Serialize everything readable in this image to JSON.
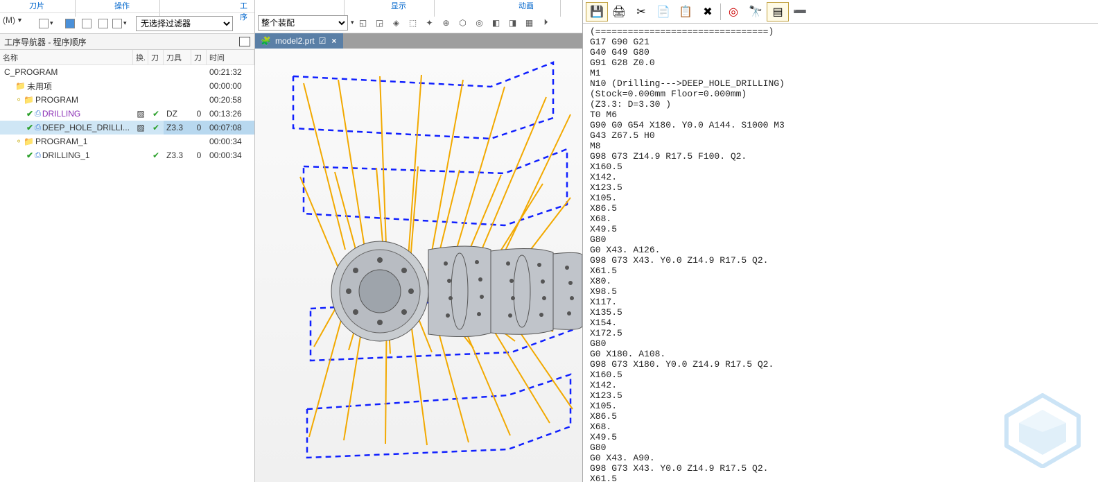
{
  "ribbon": {
    "tab_tool": "刀片",
    "tab_ops": "操作",
    "tab_prog": "工序",
    "tab_display": "显示",
    "tab_anim": "动画",
    "menu_dropdown_label": "(M)",
    "filter_placeholder": "无选择过滤器",
    "assembly_placeholder": "整个装配"
  },
  "navigator": {
    "title": "工序导航器 - 程序顺序",
    "cols": {
      "name": "名称",
      "swap": "换.",
      "tool_sym": "刀",
      "tool": "刀具",
      "tool2": "刀",
      "time": "时间"
    }
  },
  "tree": [
    {
      "indent": 0,
      "name": "C_PROGRAM",
      "icon": "",
      "time": "00:21:32",
      "swap": "",
      "check": "",
      "tool": "",
      "tool2": ""
    },
    {
      "indent": 1,
      "name": "未用项",
      "icon": "folder",
      "time": "00:00:00",
      "swap": "",
      "check": "",
      "tool": "",
      "tool2": ""
    },
    {
      "indent": 1,
      "name": "PROGRAM",
      "icon": "folder",
      "time": "00:20:58",
      "swap": "",
      "check": "",
      "tool": "",
      "tool2": "",
      "prefix_check": true,
      "bullet": true
    },
    {
      "indent": 2,
      "name": "DRILLING",
      "icon": "op",
      "time": "00:13:26",
      "swap": "▨",
      "check": "✔",
      "tool": "DZ",
      "tool2": "0",
      "prefix_check": true,
      "purple": true
    },
    {
      "indent": 2,
      "name": "DEEP_HOLE_DRILLI...",
      "icon": "op",
      "time": "00:07:08",
      "swap": "▨",
      "check": "✔",
      "tool": "Z3.3",
      "tool2": "0",
      "prefix_check": true,
      "selected": true
    },
    {
      "indent": 1,
      "name": "PROGRAM_1",
      "icon": "folder",
      "time": "00:00:34",
      "swap": "",
      "check": "",
      "tool": "",
      "tool2": "",
      "prefix_check": true,
      "bullet": true
    },
    {
      "indent": 2,
      "name": "DRILLING_1",
      "icon": "op",
      "time": "00:00:34",
      "swap": "",
      "check": "✔",
      "tool": "Z3.3",
      "tool2": "0",
      "prefix_check": true
    }
  ],
  "viewport_tab": {
    "label": "model2.prt",
    "modified_glyph": "☑"
  },
  "right_toolbar": {
    "icons": [
      "save-icon",
      "print-icon",
      "cut-icon",
      "copy-icon",
      "paste-icon",
      "delete-icon",
      "target-icon",
      "binoculars-icon",
      "editor-icon",
      "minimize-icon"
    ]
  },
  "gcode_text": "(================================)\nG17 G90 G21\nG40 G49 G80\nG91 G28 Z0.0\nM1\nN10 (Drilling--->DEEP_HOLE_DRILLING)\n(Stock=0.000mm Floor=0.000mm)\n(Z3.3: D=3.30 )\nT0 M6\nG90 G0 G54 X180. Y0.0 A144. S1000 M3\nG43 Z67.5 H0\nM8\nG98 G73 Z14.9 R17.5 F100. Q2.\nX160.5\nX142.\nX123.5\nX105.\nX86.5\nX68.\nX49.5\nG80\nG0 X43. A126.\nG98 G73 X43. Y0.0 Z14.9 R17.5 Q2.\nX61.5\nX80.\nX98.5\nX117.\nX135.5\nX154.\nX172.5\nG80\nG0 X180. A108.\nG98 G73 X180. Y0.0 Z14.9 R17.5 Q2.\nX160.5\nX142.\nX123.5\nX105.\nX86.5\nX68.\nX49.5\nG80\nG0 X43. A90.\nG98 G73 X43. Y0.0 Z14.9 R17.5 Q2.\nX61.5"
}
